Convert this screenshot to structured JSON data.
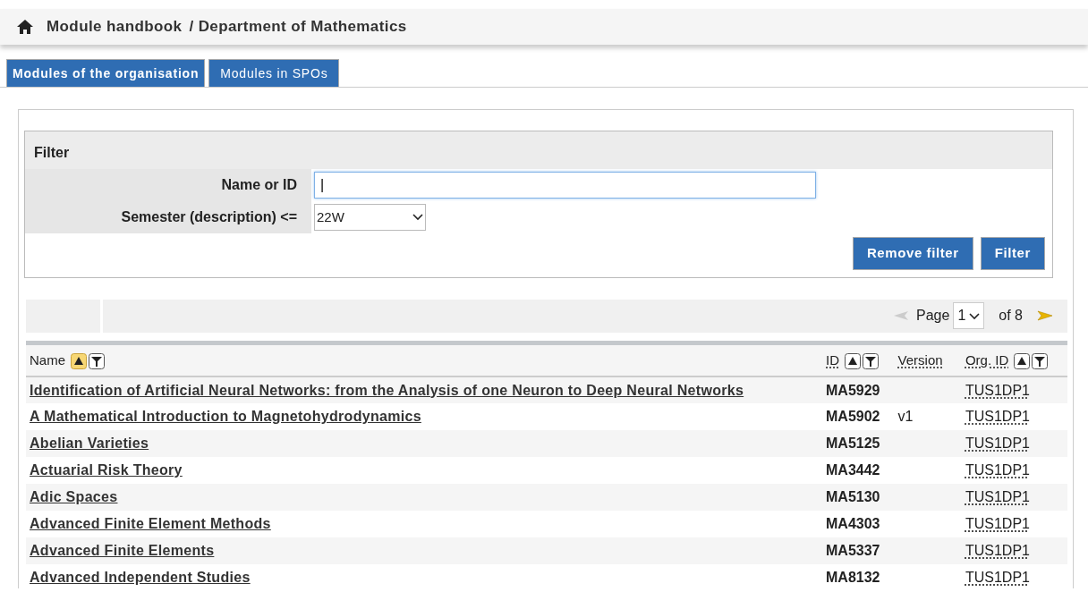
{
  "header": {
    "title": "Module handbook",
    "subtitle": "/ Department of Mathematics"
  },
  "tabs": [
    {
      "label": "Modules of the organisation",
      "selected": true
    },
    {
      "label": "Modules in SPOs",
      "selected": false
    }
  ],
  "filter": {
    "title": "Filter",
    "fields": [
      {
        "kind": "text",
        "label": "Name or ID",
        "value": "|"
      },
      {
        "kind": "select",
        "label": "Semester (description) <=",
        "value": "22W"
      }
    ],
    "buttons": [
      "Remove filter",
      "Filter"
    ]
  },
  "pager": {
    "label": "Page",
    "page": "1",
    "of": "of 8",
    "prev_disabled": true,
    "next_disabled": false
  },
  "table": {
    "columns": [
      {
        "label": "Name",
        "sortable": true,
        "sorted": true,
        "dotted": false
      },
      {
        "label": "ID",
        "sortable": true,
        "sorted": false,
        "dotted": true
      },
      {
        "label": "Version",
        "sortable": false,
        "dotted": true
      },
      {
        "label": "Org. ID",
        "sortable": true,
        "sorted": false,
        "dotted": true
      }
    ],
    "rows": [
      {
        "name": "Identification of Artificial Neural Networks: from the Analysis of one Neuron to Deep Neural Networks",
        "id": "MA5929",
        "org": "TUS1DP1"
      },
      {
        "name": "A Mathematical Introduction to Magnetohydrodynamics",
        "id": "MA5902",
        "version": "v1",
        "org": "TUS1DP1"
      },
      {
        "name": "Abelian Varieties",
        "id": "MA5125",
        "org": "TUS1DP1"
      },
      {
        "name": "Actuarial Risk Theory",
        "id": "MA3442",
        "org": "TUS1DP1"
      },
      {
        "name": "Adic Spaces",
        "id": "MA5130",
        "org": "TUS1DP1"
      },
      {
        "name": "Advanced Finite Element Methods",
        "id": "MA4303",
        "org": "TUS1DP1"
      },
      {
        "name": "Advanced Finite Elements",
        "id": "MA5337",
        "org": "TUS1DP1"
      },
      {
        "name": "Advanced Independent Studies",
        "id": "MA8132",
        "org": "TUS1DP1"
      }
    ]
  }
}
